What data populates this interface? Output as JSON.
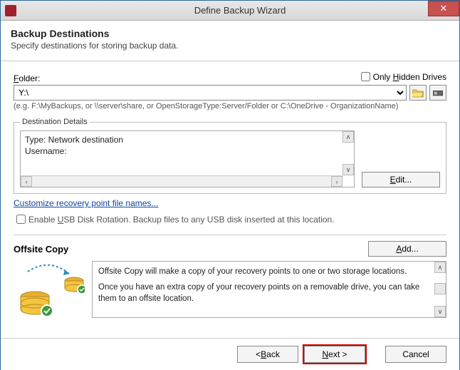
{
  "window": {
    "title": "Define Backup Wizard"
  },
  "header": {
    "title": "Backup Destinations",
    "subtitle": "Specify destinations for storing backup data."
  },
  "folder": {
    "label": "Folder:",
    "only_hidden_label": "Only Hidden Drives",
    "path": "Y:\\",
    "hint": "(e.g. F:\\MyBackups, or \\\\server\\share, or OpenStorageType:Server/Folder or C:\\OneDrive - OrganizationName)"
  },
  "destination_details": {
    "legend": "Destination Details",
    "type_line": "Type: Network destination",
    "user_line": "Username:",
    "edit_label": "Edit..."
  },
  "links": {
    "customize": "Customize recovery point file names...",
    "usb_rotation": "Enable USB Disk Rotation. Backup files to any USB disk inserted at this location."
  },
  "offsite": {
    "title": "Offsite Copy",
    "add_label": "Add...",
    "para1": "Offsite Copy will make a copy of your recovery points to one or two storage locations.",
    "para2": "Once you have an extra copy of your recovery points on a removable drive, you can take them to an offsite location."
  },
  "buttons": {
    "back": "< Back",
    "next": "Next >",
    "cancel": "Cancel"
  }
}
